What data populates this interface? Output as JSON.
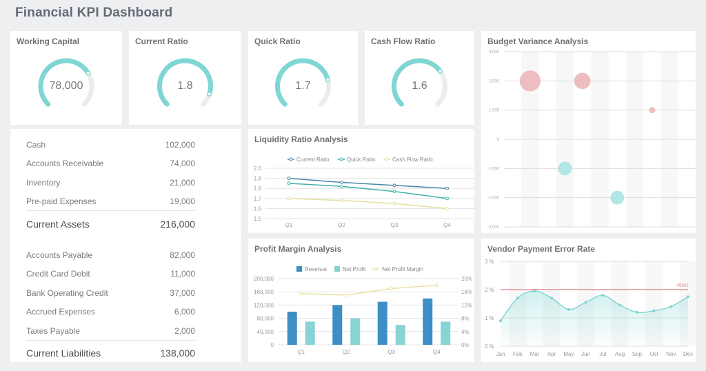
{
  "page": {
    "title": "Financial KPI Dashboard"
  },
  "colors": {
    "teal": "#7fd6d3",
    "gauge_track": "#ececec",
    "revenue": "#3d8fc6",
    "net_profit": "#88d3d4",
    "margin_line": "#e9e1a6",
    "current_ratio": "#4a86a8",
    "quick_ratio": "#3fb2aa",
    "cash_flow_ratio": "#e5df9e",
    "positive_bubble": "#ecb6b8",
    "negative_bubble": "#a9e3e2",
    "alert": "#e58e95"
  },
  "gauges": [
    {
      "title": "Working Capital",
      "value": "78,000",
      "fill": 0.72
    },
    {
      "title": "Current Ratio",
      "value": "1.8",
      "fill": 0.9
    },
    {
      "title": "Quick Ratio",
      "value": "1.7",
      "fill": 0.78
    },
    {
      "title": "Cash Flow Ratio",
      "value": "1.6",
      "fill": 0.7
    }
  ],
  "balance": {
    "assets": [
      {
        "label": "Cash",
        "value": "102,000"
      },
      {
        "label": "Accounts Receivable",
        "value": "74,000"
      },
      {
        "label": "Inventory",
        "value": "21,000"
      },
      {
        "label": "Pre-paid Expenses",
        "value": "19,000"
      }
    ],
    "assets_total": {
      "label": "Current Assets",
      "value": "216,000"
    },
    "liabilities": [
      {
        "label": "Accounts Payable",
        "value": "82,000"
      },
      {
        "label": "Credit Card Debit",
        "value": "11,000"
      },
      {
        "label": "Bank Operating Credit",
        "value": "37,000"
      },
      {
        "label": "Accrued Expenses",
        "value": "6,000"
      },
      {
        "label": "Taxes Payable",
        "value": "2,000"
      }
    ],
    "liabilities_total": {
      "label": "Current Liabilities",
      "value": "138,000"
    }
  },
  "chart_data": [
    {
      "id": "liquidity",
      "type": "line",
      "title": "Liquidity Ratio Analysis",
      "categories": [
        "Q1",
        "Q2",
        "Q3",
        "Q4"
      ],
      "series": [
        {
          "name": "Current Ratio",
          "values": [
            1.9,
            1.86,
            1.83,
            1.8
          ]
        },
        {
          "name": "Quick Ratio",
          "values": [
            1.85,
            1.82,
            1.77,
            1.7
          ]
        },
        {
          "name": "Cash Flow Ratio",
          "values": [
            1.7,
            1.68,
            1.65,
            1.6
          ]
        }
      ],
      "ylim": [
        1.5,
        2.0
      ],
      "yticks": [
        "1.5",
        "1.6",
        "1.7",
        "1.8",
        "1.9",
        "2.0"
      ],
      "legend": "top",
      "grid": true
    },
    {
      "id": "profit",
      "type": "bar",
      "title": "Profit Margin Analysis",
      "categories": [
        "Q1",
        "Q2",
        "Q3",
        "Q4"
      ],
      "series": [
        {
          "name": "Revenue",
          "type": "bar",
          "values": [
            100000,
            120000,
            130000,
            140000
          ]
        },
        {
          "name": "Net Profit",
          "type": "bar",
          "values": [
            70000,
            80000,
            60000,
            70000
          ]
        },
        {
          "name": "Net Profit Margin",
          "type": "line",
          "axis": "right",
          "values": [
            15.5,
            15,
            17,
            18
          ]
        }
      ],
      "ylim": [
        0,
        200000
      ],
      "yticks": [
        "0",
        "40,000",
        "80,000",
        "120,000",
        "160,000",
        "200,000"
      ],
      "y2lim": [
        0,
        20
      ],
      "y2ticks": [
        "0%",
        "4%",
        "8%",
        "12%",
        "16%",
        "20%"
      ],
      "legend": "top",
      "grid": true
    },
    {
      "id": "budget",
      "type": "scatter",
      "title": "Budget Variance Analysis",
      "x_categories": 11,
      "points": [
        {
          "x": 1.5,
          "y": 2000,
          "size": 3
        },
        {
          "x": 3.5,
          "y": -1000,
          "size": 1
        },
        {
          "x": 4.5,
          "y": 2000,
          "size": 1.6
        },
        {
          "x": 6.5,
          "y": -2000,
          "size": 1
        },
        {
          "x": 8.5,
          "y": 1000,
          "size": 0.3
        }
      ],
      "ylim": [
        -3000,
        3000
      ],
      "yticks": [
        "-3,000",
        "-2,000",
        "-1,000",
        "0",
        "1,000",
        "2,000",
        "3,000"
      ],
      "grid": true
    },
    {
      "id": "vendor",
      "type": "area",
      "title": "Vendor Payment Error Rate",
      "categories": [
        "Jan",
        "Feb",
        "Mar",
        "Apr",
        "May",
        "Jun",
        "Jul",
        "Aug",
        "Sep",
        "Oct",
        "Nov",
        "Dec"
      ],
      "values": [
        0.9,
        1.7,
        1.95,
        1.7,
        1.3,
        1.55,
        1.8,
        1.45,
        1.2,
        1.25,
        1.4,
        1.75
      ],
      "ylim": [
        0,
        3
      ],
      "yticks": [
        "0 %",
        "1 %",
        "2 %",
        "3 %"
      ],
      "annotation": {
        "label": "Alert",
        "value": 2
      },
      "grid": true
    }
  ]
}
